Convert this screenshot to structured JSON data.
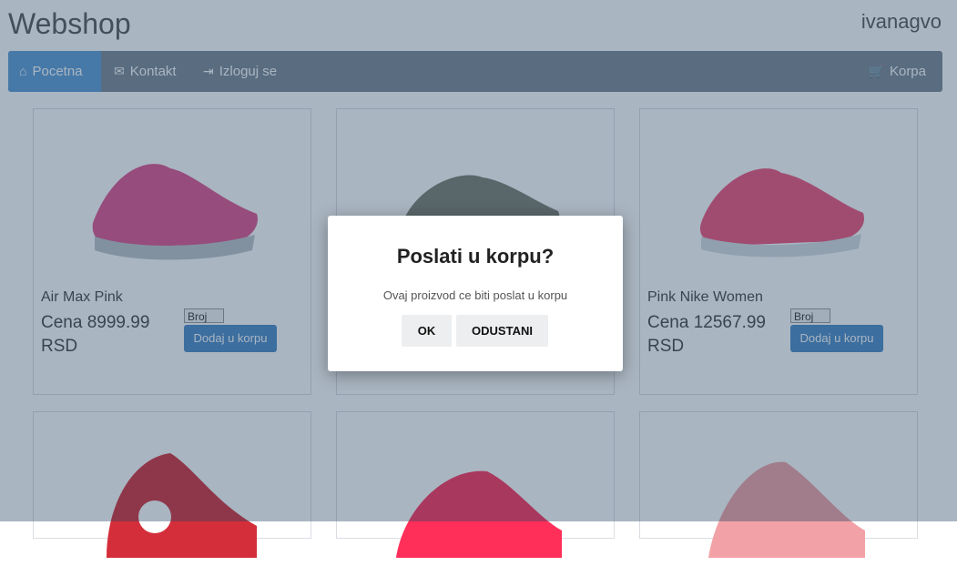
{
  "brand": "Webshop",
  "user": "ivanagvo",
  "nav": {
    "home": "Pocetna",
    "contact": "Kontakt",
    "logout": "Izloguj se",
    "cart": "Korpa"
  },
  "products": [
    {
      "name": "Air Max Pink",
      "price": "Cena 8999.99 RSD",
      "select": "Broj",
      "button": "Dodaj u korpu",
      "color": "#e0508c"
    },
    {
      "name": "",
      "price": "",
      "select": "",
      "button": "",
      "color": "#7b7d6e"
    },
    {
      "name": "Pink Nike Women",
      "price": "Cena 12567.99 RSD",
      "select": "Broj",
      "button": "Dodaj u korpu",
      "color": "#f0507a"
    },
    {
      "name": "",
      "price": "",
      "select": "",
      "button": "",
      "color": "#d42e3a"
    },
    {
      "name": "",
      "price": "",
      "select": "",
      "button": "",
      "color": "#ff2f5a"
    },
    {
      "name": "",
      "price": "",
      "select": "",
      "button": "",
      "color": "#f2a2a6"
    }
  ],
  "modal": {
    "title": "Poslati u korpu?",
    "text": "Ovaj proizvod ce biti poslat u korpu",
    "ok": "OK",
    "cancel": "ODUSTANI"
  },
  "icons": {
    "home": "home-icon",
    "contact": "envelope-icon",
    "logout": "logout-icon",
    "cart": "cart-icon"
  }
}
